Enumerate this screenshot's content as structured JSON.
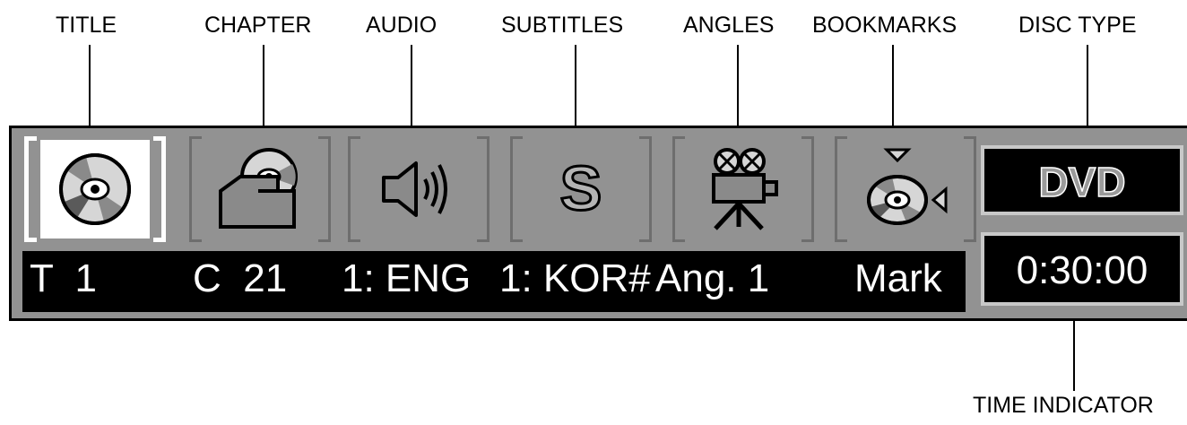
{
  "callouts": {
    "title": "TITLE",
    "chapter": "CHAPTER",
    "audio": "AUDIO",
    "subtitles": "SUBTITLES",
    "angles": "ANGLES",
    "bookmarks": "BOOKMARKS",
    "disc_type": "DISC TYPE",
    "time_indicator": "TIME INDICATOR"
  },
  "icons": [
    "disc-icon",
    "chapter-folder-icon",
    "speaker-icon",
    "subtitle-s-icon",
    "movie-camera-icon",
    "bookmark-disc-icon"
  ],
  "subtitle_glyph": "S",
  "info": {
    "title": "T  1",
    "chapter": "C  21",
    "audio": "1: ENG",
    "subtitle": "1: KOR#",
    "angle": "Ang. 1",
    "mark": "Mark"
  },
  "disc_type": "DVD",
  "time": "0:30:00",
  "colors": {
    "panel": "#929292",
    "active": "#ffffff",
    "inactive_bracket": "#6e6e6e",
    "display_bg": "#000000"
  }
}
